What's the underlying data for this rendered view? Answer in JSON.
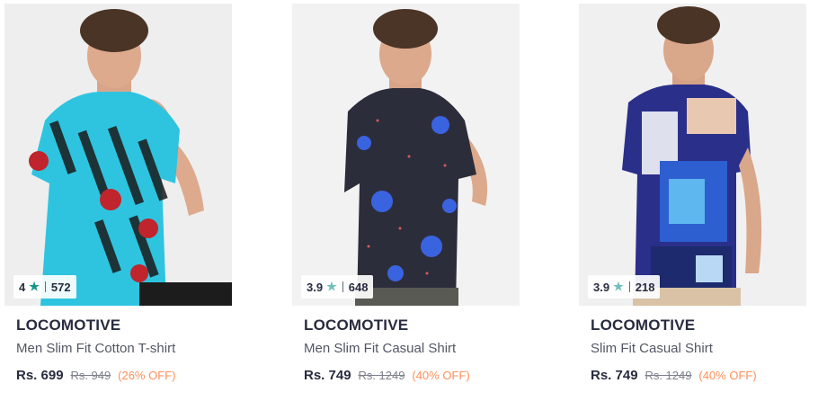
{
  "products": [
    {
      "rating": "4",
      "rating_count": "572",
      "star_color": "#14958f",
      "brand": "LOCOMOTIVE",
      "name": "Men Slim Fit Cotton T-shirt",
      "price": "Rs. 699",
      "mrp": "Rs. 949",
      "discount": "(26% OFF)",
      "image_icon": "model-in-cyan-tshirt"
    },
    {
      "rating": "3.9",
      "rating_count": "648",
      "star_color": "#72bfbc",
      "brand": "LOCOMOTIVE",
      "name": "Men Slim Fit Casual Shirt",
      "price": "Rs. 749",
      "mrp": "Rs. 1249",
      "discount": "(40% OFF)",
      "image_icon": "model-in-navy-floral-shirt"
    },
    {
      "rating": "3.9",
      "rating_count": "218",
      "star_color": "#72bfbc",
      "brand": "LOCOMOTIVE",
      "name": "Slim Fit Casual Shirt",
      "price": "Rs. 749",
      "mrp": "Rs. 1249",
      "discount": "(40% OFF)",
      "image_icon": "model-in-printed-shirt"
    }
  ]
}
